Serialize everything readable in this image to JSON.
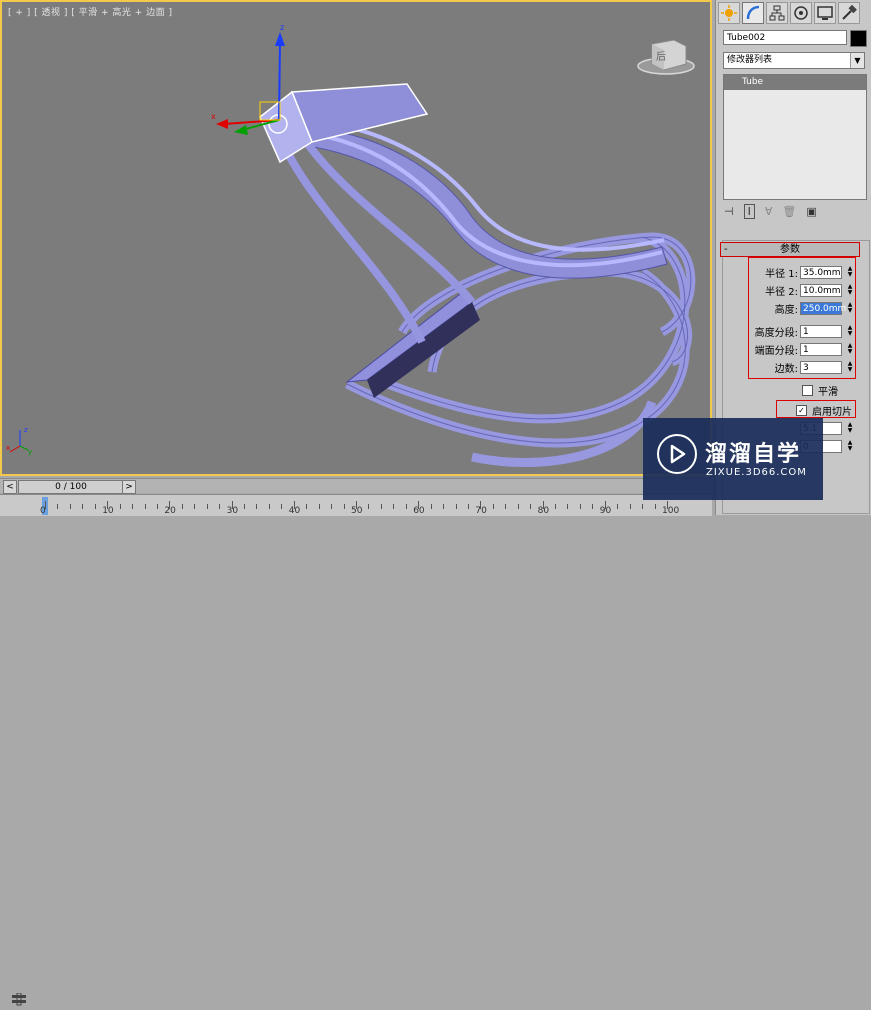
{
  "viewport": {
    "label": "[ + ] [ 透视 ] [ 平滑 + 高光 + 边面 ]",
    "viewcube_label": "后",
    "axis_labels": {
      "x": "x",
      "y": "y",
      "z": "z"
    }
  },
  "command_panel": {
    "object_name": "Tube002",
    "modifier_list": "修改器列表",
    "stack_items": [
      "Tube"
    ],
    "rollout_title": "参数",
    "rollout_toggle": "-",
    "params": [
      {
        "label": "半径 1:",
        "value": "35.0mm",
        "selected": false
      },
      {
        "label": "半径 2:",
        "value": "10.0mm",
        "selected": false
      },
      {
        "label": "高度:",
        "value": "250.0mm",
        "selected": true
      },
      {
        "label": "高度分段:",
        "value": "1",
        "selected": false
      },
      {
        "label": "端面分段:",
        "value": "1",
        "selected": false
      },
      {
        "label": "边数:",
        "value": "3",
        "selected": false
      }
    ],
    "smooth_label": "平滑",
    "slice_label": "启用切片",
    "slice_checked": true,
    "partial_value_1": "5.1",
    "partial_value_2": "0"
  },
  "timeline": {
    "frame_label": "0 / 100",
    "prev": "<",
    "next": ">"
  },
  "ruler": {
    "labels": [
      "0",
      "10",
      "20",
      "30",
      "40",
      "50",
      "60",
      "70",
      "80",
      "90",
      "100"
    ]
  },
  "watermark": {
    "title": "溜溜自学",
    "subtitle": "ZIXUE.3D66.COM"
  },
  "colors": {
    "viewport_bg": "#7c7c7c",
    "active_border": "#f2c94c",
    "mesh": "#8c8cd8",
    "highlight": "#d00000"
  }
}
